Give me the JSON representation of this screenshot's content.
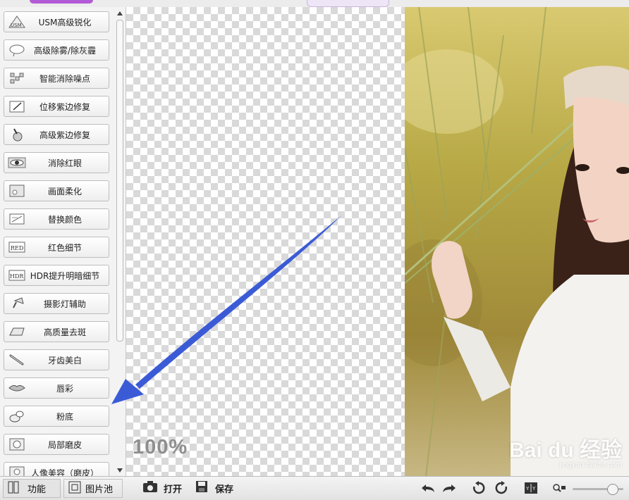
{
  "tools": [
    {
      "label": "USM高级锐化",
      "icon": "usm-icon"
    },
    {
      "label": "高级除雾/除灰霾",
      "icon": "cloud-icon"
    },
    {
      "label": "智能消除噪点",
      "icon": "noise-icon"
    },
    {
      "label": "位移紫边修复",
      "icon": "pen-frame-icon"
    },
    {
      "label": "高级紫边修复",
      "icon": "brush-icon"
    },
    {
      "label": "消除红眼",
      "icon": "eye-icon"
    },
    {
      "label": "画面柔化",
      "icon": "soften-icon"
    },
    {
      "label": "替换颜色",
      "icon": "replace-color-icon"
    },
    {
      "label": "红色细节",
      "icon": "red-icon"
    },
    {
      "label": "HDR提升明暗细节",
      "icon": "hdr-icon"
    },
    {
      "label": "摄影灯辅助",
      "icon": "lamp-icon"
    },
    {
      "label": "高质量去斑",
      "icon": "eraser-icon"
    },
    {
      "label": "牙齿美白",
      "icon": "toothbrush-icon"
    },
    {
      "label": "唇彩",
      "icon": "lips-icon"
    },
    {
      "label": "粉底",
      "icon": "compact-icon"
    },
    {
      "label": "局部磨皮",
      "icon": "face-icon"
    },
    {
      "label": "人像美容（磨皮）",
      "icon": "portrait-icon"
    }
  ],
  "canvas": {
    "zoom": "100%"
  },
  "photo": {
    "watermark": "Bai du 经验",
    "watermark_url": "jingyan.baidu.com"
  },
  "bottom": {
    "tab_function": "功能",
    "tab_pictures": "图片池",
    "open": "打开",
    "save": "保存",
    "zoom_level": 0.78
  },
  "colors": {
    "arrow": "#3b5bd6",
    "accent": "#b35ad6"
  }
}
